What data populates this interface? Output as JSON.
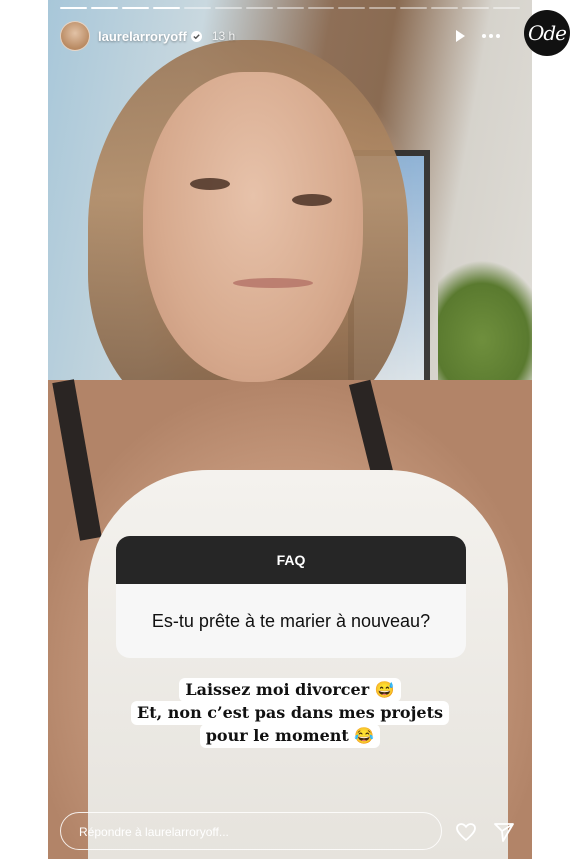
{
  "story": {
    "username": "laurelarroryoff",
    "time_ago": "13 h",
    "progress": {
      "total_segments": 15,
      "completed_segments": 4
    }
  },
  "logo": {
    "text": "Ode"
  },
  "faq": {
    "header": "FAQ",
    "question": "Es-tu prête à te marier à nouveau?"
  },
  "reply_caption": {
    "lines": [
      "Laissez moi divorcer 😅",
      "Et, non c’est pas dans mes projets",
      "pour le moment 😂"
    ]
  },
  "reply_bar": {
    "placeholder": "Répondre à laurelarroryoff..."
  },
  "icons": [
    "verified-icon",
    "play-icon",
    "more-icon",
    "heart-icon",
    "send-icon"
  ]
}
